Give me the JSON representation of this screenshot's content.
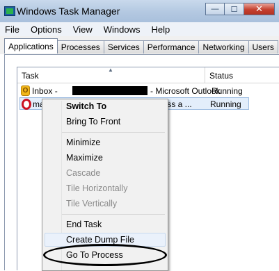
{
  "window": {
    "title": "Windows Task Manager",
    "buttons": {
      "minimize_glyph": "—",
      "maximize_glyph": "☐",
      "close_glyph": "✕"
    }
  },
  "menu": [
    "File",
    "Options",
    "View",
    "Windows",
    "Help"
  ],
  "tabs": [
    "Applications",
    "Processes",
    "Services",
    "Performance",
    "Networking",
    "Users"
  ],
  "active_tab": "Applications",
  "columns": {
    "task": "Task",
    "status": "Status"
  },
  "rows": [
    {
      "icon": "outlook-icon",
      "task_prefix": "Inbox -",
      "task_suffix": "- Microsoft Outlook",
      "status": "Running",
      "redacted": true
    },
    {
      "icon": "opera-icon",
      "task_prefix": "ma",
      "task_suffix": "rocess a ...",
      "status": "Running",
      "selected": true
    }
  ],
  "context_menu": {
    "items": [
      {
        "label": "Switch To",
        "bold": true,
        "enabled": true
      },
      {
        "label": "Bring To Front",
        "enabled": true
      },
      {
        "label": "Minimize",
        "enabled": true
      },
      {
        "label": "Maximize",
        "enabled": true
      },
      {
        "label": "Cascade",
        "enabled": false
      },
      {
        "label": "Tile Horizontally",
        "enabled": false
      },
      {
        "label": "Tile Vertically",
        "enabled": false
      },
      {
        "label": "End Task",
        "enabled": true
      },
      {
        "label": "Create Dump File",
        "enabled": true
      },
      {
        "label": "Go To Process",
        "enabled": true,
        "highlighted_by_annotation": true
      }
    ]
  },
  "colors": {
    "selection": "#e3eefb",
    "annotation": "#000000",
    "close_button": "#c5402f"
  }
}
